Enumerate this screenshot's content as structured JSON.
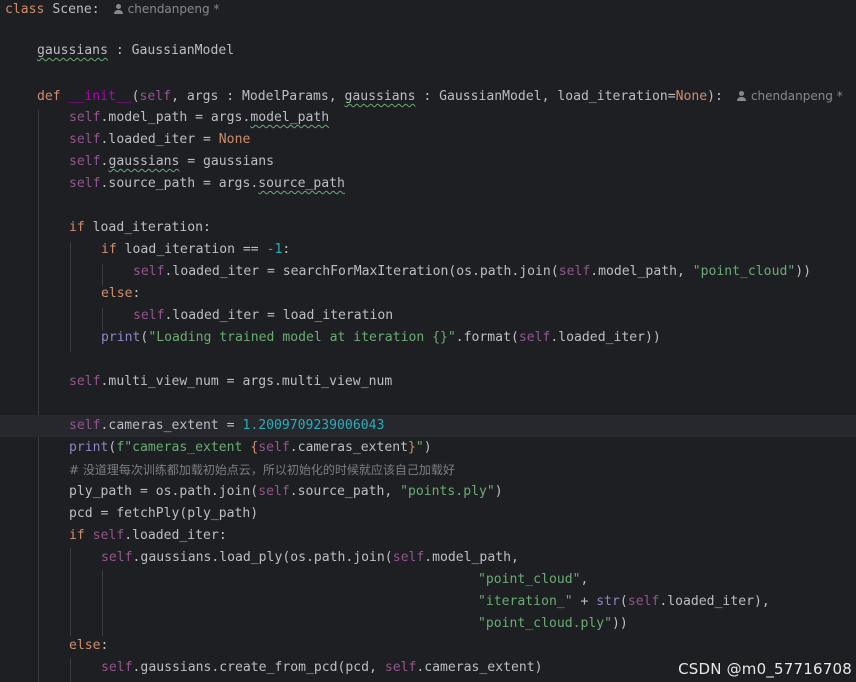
{
  "editor": {
    "author_hint": "chendanpeng *",
    "class_keyword": "class",
    "class_name": "Scene:",
    "field_name": "gaussians",
    "field_colon": " : ",
    "field_type": "GaussianModel",
    "def_line": {
      "kw": "def",
      "name": "__init__",
      "open": "(",
      "self": "self",
      "args": ", args : ModelParams, ",
      "gaussians": "gaussians",
      "mid": " : GaussianModel, load_iteration=",
      "none": "None",
      "close": "):"
    },
    "line_model_path": {
      "self": "self",
      "a": ".model_path = args.",
      "b": "model_path"
    },
    "line_loaded_iter": {
      "self": "self",
      "a": ".loaded_iter = ",
      "none": "None"
    },
    "line_gaussians": {
      "self": "self",
      "a": ".",
      "b": "gaussians",
      "c": " = gaussians"
    },
    "line_source_path": {
      "self": "self",
      "a": ".source_path = args.",
      "b": "source_path"
    },
    "line_if_load": {
      "kw": "if",
      "rest": " load_iteration:"
    },
    "line_if_minus1": {
      "kw": "if",
      "rest": " load_iteration == ",
      "num": "-1",
      "end": ":"
    },
    "line_search": {
      "self": "self",
      "a": ".loaded_iter = searchForMaxIteration(os.path.join(",
      "self2": "self",
      "b": ".model_path, ",
      "str": "\"point_cloud\"",
      "c": "))"
    },
    "line_else1": {
      "kw": "else",
      "rest": ":"
    },
    "line_assign_iter": {
      "self": "self",
      "a": ".loaded_iter = load_iteration"
    },
    "line_print1": {
      "fn": "print",
      "a": "(",
      "str": "\"Loading trained model at iteration {}\"",
      "b": ".format(",
      "self": "self",
      "c": ".loaded_iter))"
    },
    "line_multi_view": {
      "self": "self",
      "a": ".multi_view_num = args.multi_view_num"
    },
    "line_cameras": {
      "self": "self",
      "a": ".cameras_extent = ",
      "num": "1.2009709239006043"
    },
    "line_print2": {
      "fn": "print",
      "a": "(",
      "s1": "f\"cameras_extent ",
      "b1": "{",
      "self": "self",
      "mid": ".cameras_extent",
      "b2": "}",
      "s2": "\"",
      "c": ")"
    },
    "line_comment": "# 没道理每次训练都加载初始点云，所以初始化的时候就应该自己加载好",
    "line_ply_path": {
      "a": "ply_path = os.path.join(",
      "self": "self",
      "b": ".source_path, ",
      "str": "\"points.ply\"",
      "c": ")"
    },
    "line_pcd": {
      "a": "pcd = fetchPly(ply_path)"
    },
    "line_if_loaded": {
      "kw": "if",
      "sp": " ",
      "self": "self",
      "rest": ".loaded_iter:"
    },
    "line_load_ply": {
      "self": "self",
      "a": ".gaussians.load_ply(os.path.join(",
      "self2": "self",
      "b": ".model_path,"
    },
    "line_pc_str": {
      "str": "\"point_cloud\"",
      "c": ","
    },
    "line_iter_str": {
      "str": "\"iteration_\"",
      "a": " + ",
      "bi": "str",
      "b": "(",
      "self": "self",
      "c": ".loaded_iter),"
    },
    "line_pcply_str": {
      "str": "\"point_cloud.ply\"",
      "c": "))"
    },
    "line_else2": {
      "kw": "else",
      "rest": ":"
    },
    "line_create": {
      "self": "self",
      "a": ".gaussians.create_from_pcd(pcd, ",
      "self2": "self",
      "b": ".cameras_extent)"
    }
  },
  "watermark": "CSDN @m0_57716708",
  "colors": {
    "background": "#1e1f22",
    "keyword": "#cf8e6d",
    "self": "#94558d",
    "string": "#6aab73",
    "number": "#2aacb8",
    "comment": "#7a7e85"
  }
}
